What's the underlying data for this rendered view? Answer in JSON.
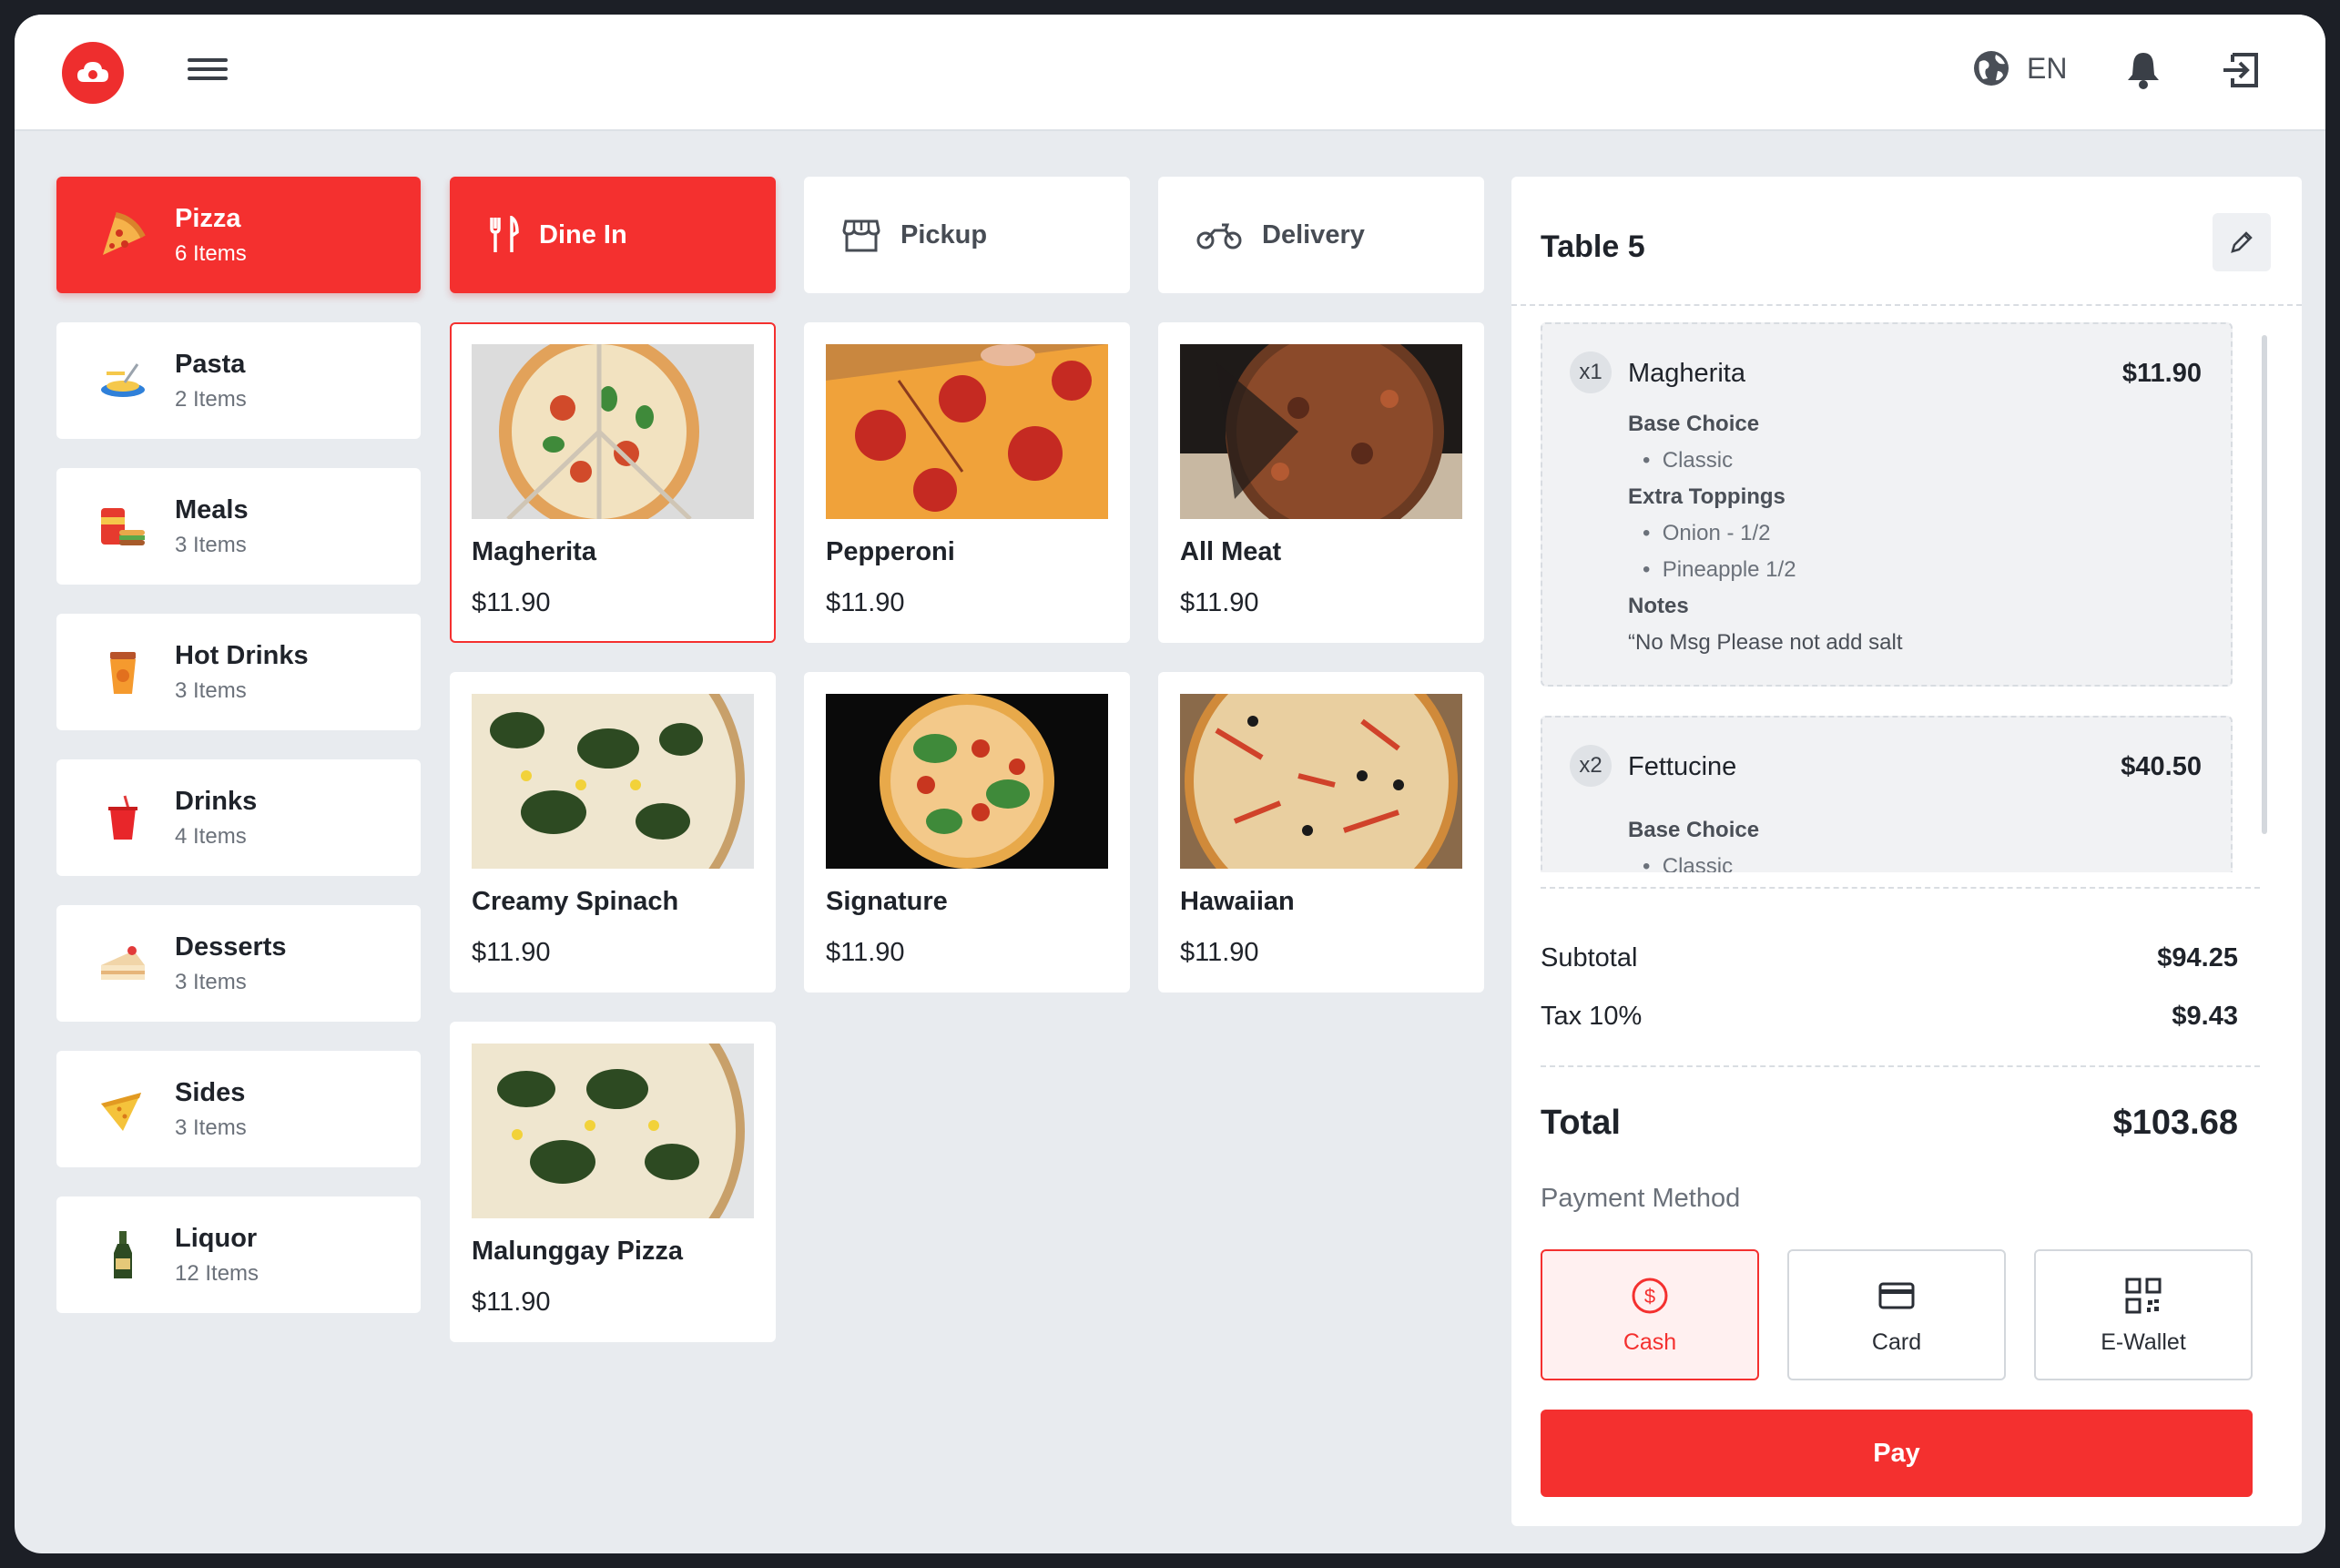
{
  "header": {
    "language": "EN"
  },
  "categories": [
    {
      "name": "Pizza",
      "count": "6 Items",
      "icon": "pizza-icon",
      "active": true
    },
    {
      "name": "Pasta",
      "count": "2 Items",
      "icon": "pasta-icon"
    },
    {
      "name": "Meals",
      "count": "3 Items",
      "icon": "meals-icon"
    },
    {
      "name": "Hot Drinks",
      "count": "3 Items",
      "icon": "hot-drink-icon"
    },
    {
      "name": "Drinks",
      "count": "4 Items",
      "icon": "drink-icon"
    },
    {
      "name": "Desserts",
      "count": "3 Items",
      "icon": "dessert-icon"
    },
    {
      "name": "Sides",
      "count": "3 Items",
      "icon": "sides-icon"
    },
    {
      "name": "Liquor",
      "count": "12 Items",
      "icon": "liquor-icon"
    }
  ],
  "order_types": [
    {
      "label": "Dine In",
      "icon": "fork-knife-icon",
      "active": true
    },
    {
      "label": "Pickup",
      "icon": "store-icon"
    },
    {
      "label": "Delivery",
      "icon": "motorbike-icon"
    }
  ],
  "products": [
    {
      "name": "Magherita",
      "price": "$11.90",
      "selected": true
    },
    {
      "name": "Pepperoni",
      "price": "$11.90"
    },
    {
      "name": "All Meat",
      "price": "$11.90"
    },
    {
      "name": "Creamy Spinach",
      "price": "$11.90"
    },
    {
      "name": "Signature",
      "price": "$11.90"
    },
    {
      "name": "Hawaiian",
      "price": "$11.90"
    },
    {
      "name": "Malunggay Pizza",
      "price": "$11.90"
    }
  ],
  "order": {
    "table": "Table 5",
    "items": [
      {
        "qty": "x1",
        "name": "Magherita",
        "price": "$11.90",
        "base_heading": "Base Choice",
        "base": "Classic",
        "toppings_heading": "Extra Toppings",
        "toppings": [
          "Onion - 1/2",
          "Pineapple 1/2"
        ],
        "notes_heading": "Notes",
        "notes": "“No Msg Please not add salt"
      },
      {
        "qty": "x2",
        "name": "Fettucine",
        "price": "$40.50",
        "base_heading": "Base Choice",
        "base": "Classic"
      }
    ],
    "subtotal_label": "Subtotal",
    "subtotal": "$94.25",
    "tax_label": "Tax 10%",
    "tax": "$9.43",
    "total_label": "Total",
    "total": "$103.68",
    "payment_label": "Payment Method",
    "payment_methods": [
      {
        "label": "Cash",
        "icon": "dollar-circle-icon",
        "active": true
      },
      {
        "label": "Card",
        "icon": "credit-card-icon"
      },
      {
        "label": "E-Wallet",
        "icon": "qr-code-icon"
      }
    ],
    "pay_label": "Pay"
  },
  "colors": {
    "accent": "#f4302f",
    "background": "#e8ebef"
  }
}
